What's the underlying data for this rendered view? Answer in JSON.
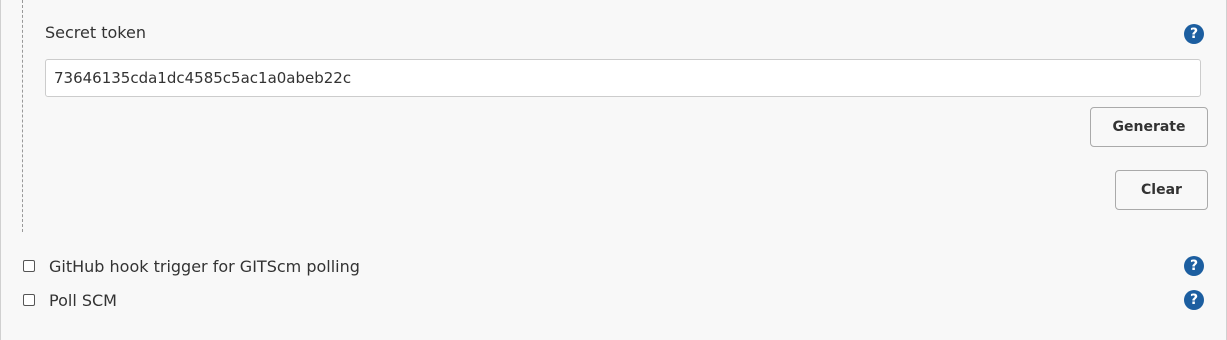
{
  "secret_token": {
    "label": "Secret token",
    "value": "73646135cda1dc4585c5ac1a0abeb22c",
    "help_glyph": "?"
  },
  "buttons": {
    "generate": "Generate",
    "clear": "Clear"
  },
  "triggers": [
    {
      "label": "GitHub hook trigger for GITScm polling",
      "checked": false,
      "help_glyph": "?"
    },
    {
      "label": "Poll SCM",
      "checked": false,
      "help_glyph": "?"
    }
  ],
  "colors": {
    "help_icon_bg": "#1c5ea0",
    "background": "#f8f8f8"
  }
}
